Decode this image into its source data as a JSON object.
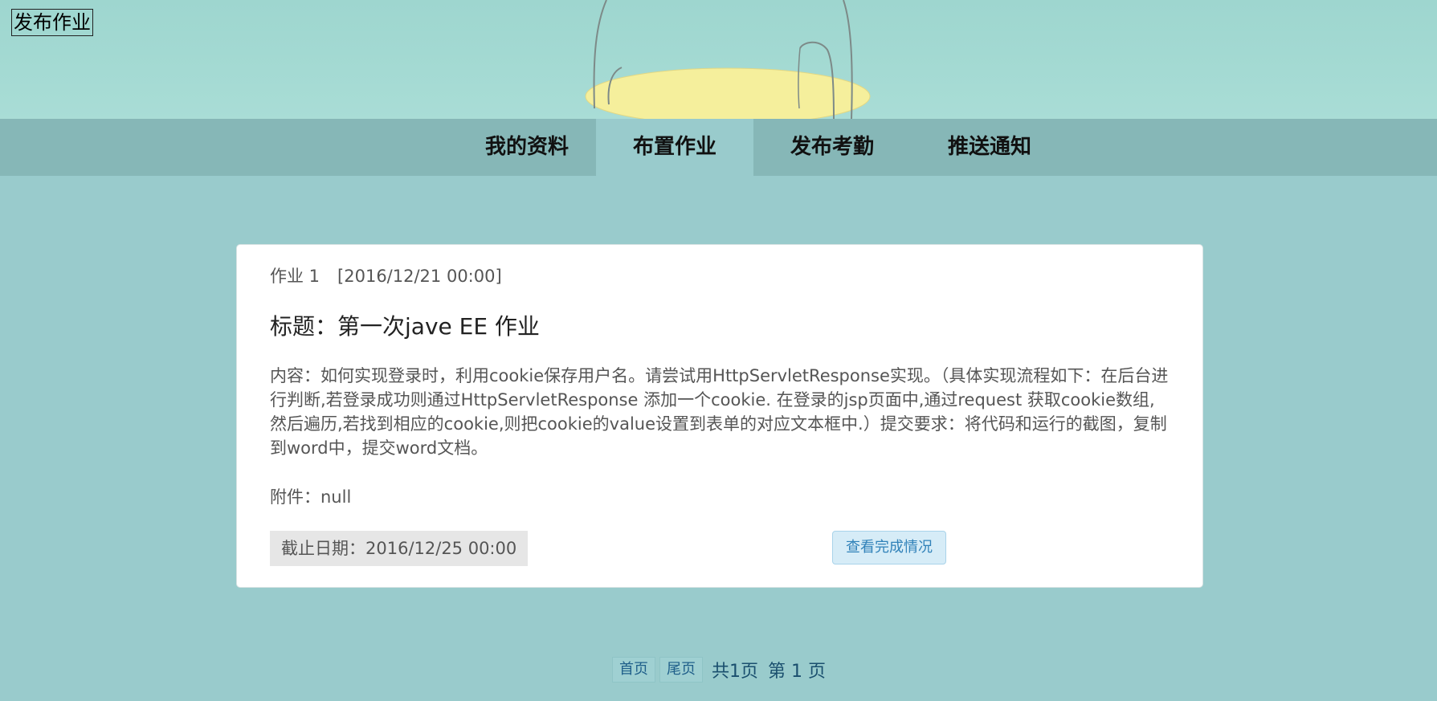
{
  "header": {
    "publish_link": "发布作业"
  },
  "nav": {
    "items": [
      {
        "label": "我的资料",
        "active": false
      },
      {
        "label": "布置作业",
        "active": true
      },
      {
        "label": "发布考勤",
        "active": false
      },
      {
        "label": "推送通知",
        "active": false
      }
    ]
  },
  "homework": {
    "number_label": "作业 1",
    "published": "[2016/12/21 00:00]",
    "title": "标题：第一次jave EE 作业",
    "content": "内容：如何实现登录时，利用cookie保存用户名。请尝试用HttpServletResponse实现。（具体实现流程如下：在后台进行判断,若登录成功则通过HttpServletResponse 添加一个cookie. 在登录的jsp页面中,通过request 获取cookie数组,然后遍历,若找到相应的cookie,则把cookie的value设置到表单的对应文本框中.）提交要求：将代码和运行的截图，复制到word中，提交word文档。",
    "attachment": "附件：null",
    "deadline": "截止日期：2016/12/25 00:00",
    "view_button": "查看完成情况"
  },
  "pagination": {
    "first": "首页",
    "last": "尾页",
    "total": "共1页",
    "current": "第 1 页"
  },
  "colors": {
    "page_bg": "#99cbcc",
    "nav_bg": "#86b7b7",
    "banner_bg": "#a4dad3",
    "button_text": "#3182b9"
  }
}
